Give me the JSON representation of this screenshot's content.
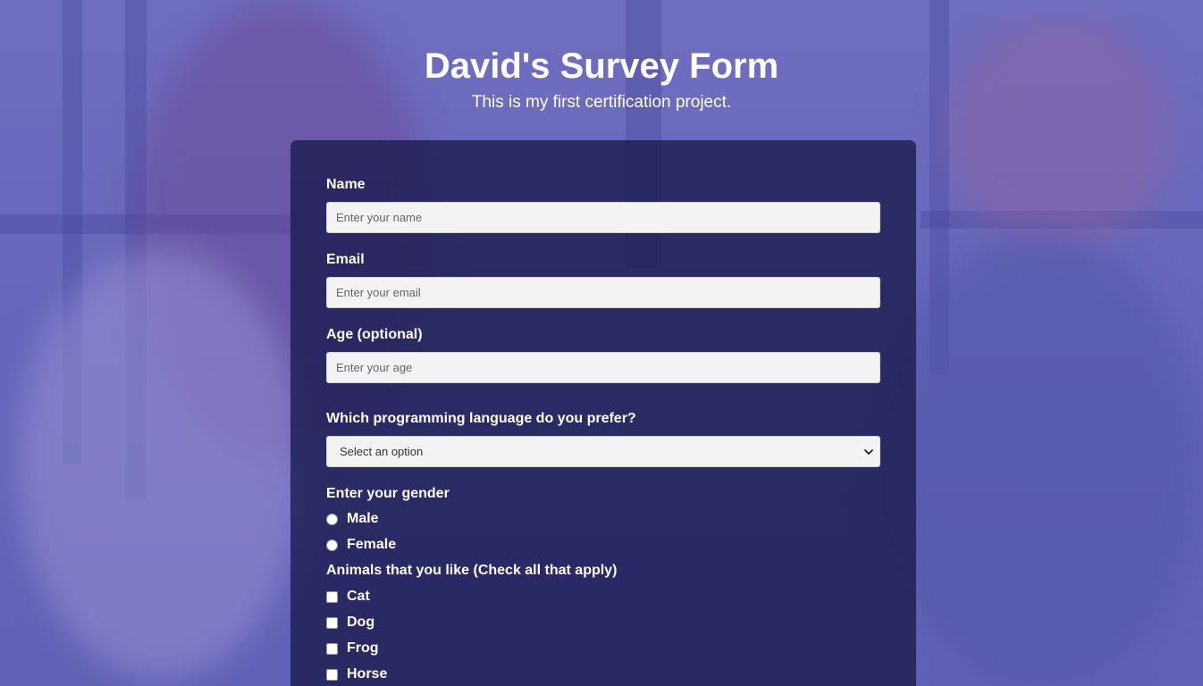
{
  "header": {
    "title": "David's Survey Form",
    "description": "This is my first certification project."
  },
  "form": {
    "name": {
      "label": "Name",
      "placeholder": "Enter your name"
    },
    "email": {
      "label": "Email",
      "placeholder": "Enter your email"
    },
    "age": {
      "label": "Age (optional)",
      "placeholder": "Enter your age"
    },
    "language": {
      "label": "Which programming language do you prefer?",
      "selected": "Select an option"
    },
    "gender": {
      "label": "Enter your gender",
      "options": [
        "Male",
        "Female"
      ]
    },
    "animals": {
      "label": "Animals that you like (Check all that apply)",
      "options": [
        "Cat",
        "Dog",
        "Frog",
        "Horse"
      ]
    }
  },
  "colors": {
    "page_overlay": "#6f6cc0",
    "card_background": "#1b1c50",
    "text": "#ffffff",
    "input_background": "#f3f3f3"
  }
}
